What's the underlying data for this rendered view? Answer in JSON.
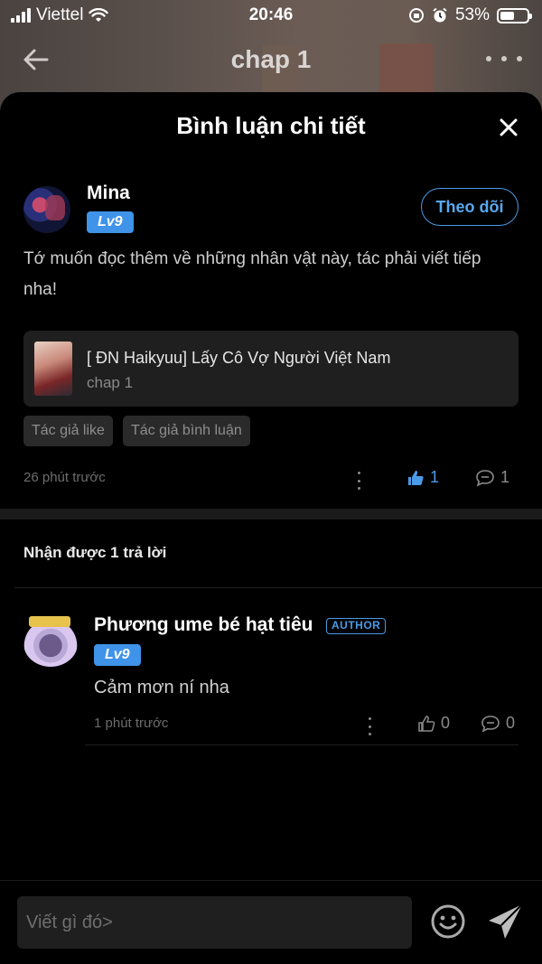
{
  "status_bar": {
    "carrier": "Viettel",
    "time": "20:46",
    "battery": "53%",
    "battery_level": 0.53
  },
  "nav": {
    "title": "chap 1"
  },
  "sheet": {
    "title": "Bình luận chi tiết"
  },
  "comment": {
    "user_name": "Mina",
    "level": "Lv9",
    "follow_label": "Theo dõi",
    "text": "Tớ muốn đọc thêm về những nhân vật này, tác phải viết tiếp nha!",
    "chapter_card": {
      "title": "[ ĐN Haikyuu] Lấy Cô Vợ Người Việt Nam",
      "subtitle": "chap 1"
    },
    "tags": [
      "Tác giả like",
      "Tác giả bình luận"
    ],
    "time": "26 phút trước",
    "likes": "1",
    "replies": "1"
  },
  "replies_section": {
    "header": "Nhận được 1 trả lời"
  },
  "reply": {
    "user_name": "Phương ume bé hạt tiêu",
    "author_badge": "AUTHOR",
    "level": "Lv9",
    "text": "Cảm mơn ní nha",
    "time": "1 phút trước",
    "likes": "0",
    "replies": "0"
  },
  "input": {
    "placeholder": "Viết gì đó>"
  },
  "colors": {
    "accent": "#4a9ae6",
    "badge": "#3f93e8",
    "background": "#000000"
  }
}
